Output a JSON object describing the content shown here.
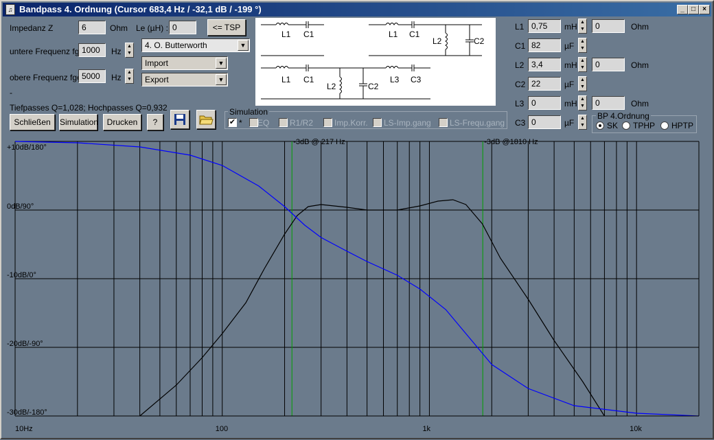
{
  "window": {
    "title": "Bandpass 4. Ordnung (Cursor 683,4 Hz / -32,1 dB / -199 °)",
    "icon": "speaker-icon"
  },
  "left": {
    "impedanz_label": "Impedanz Z",
    "impedanz_value": "6",
    "impedanz_unit": "Ohm",
    "le_label": "Le (µH) :",
    "le_value": "0",
    "tsp_label": "<= TSP",
    "fgu_label": "untere Frequenz fgu",
    "fgu_value": "1000",
    "fgu_unit": "Hz",
    "fgo_label": "obere Frequenz fgo",
    "fgo_value": "5000",
    "fgo_unit": "Hz",
    "filter_type": "4. O. Butterworth",
    "import_label": "Import",
    "export_label": "Export",
    "dot": "-",
    "q_text": "Tiefpasses Q=1,028; Hochpasses Q=0,932"
  },
  "buttons": {
    "close": "Schließen",
    "simulation": "Simulation",
    "print": "Drucken",
    "help": "?"
  },
  "schematic": {
    "l1": "L1",
    "c1": "C1",
    "l2": "L2",
    "c2": "C2",
    "l3": "L3",
    "c3": "C3"
  },
  "simulation": {
    "title": "Simulation",
    "items": [
      {
        "label": "*",
        "checked": true
      },
      {
        "label": "EQ",
        "checked": false
      },
      {
        "label": "R1/R2",
        "checked": false
      },
      {
        "label": "Imp.Korr.",
        "checked": false
      },
      {
        "label": "LS-Imp.gang",
        "checked": false
      },
      {
        "label": "LS-Frequ.gang",
        "checked": false
      }
    ]
  },
  "components": [
    {
      "name": "L1",
      "value": "0,75",
      "unit": "mH",
      "ohm": "0",
      "ohm_unit": "Ohm"
    },
    {
      "name": "C1",
      "value": "82",
      "unit": "µF"
    },
    {
      "name": "L2",
      "value": "3,4",
      "unit": "mH",
      "ohm": "0",
      "ohm_unit": "Ohm"
    },
    {
      "name": "C2",
      "value": "22",
      "unit": "µF"
    },
    {
      "name": "L3",
      "value": "0",
      "unit": "mH",
      "ohm": "0",
      "ohm_unit": "Ohm"
    },
    {
      "name": "C3",
      "value": "0",
      "unit": "µF"
    }
  ],
  "bp_group": {
    "title": "BP 4.Ordnung",
    "options": [
      "SK",
      "TPHP",
      "HPTP"
    ],
    "selected": "SK"
  },
  "chart_data": {
    "type": "line",
    "x_scale": "log",
    "xlim": [
      10,
      20000
    ],
    "x_ticks": [
      {
        "value": 10,
        "label": "10Hz"
      },
      {
        "value": 100,
        "label": "100"
      },
      {
        "value": 1000,
        "label": "1k"
      },
      {
        "value": 10000,
        "label": "10k"
      }
    ],
    "ylim": [
      -30,
      10
    ],
    "y_ticks": [
      {
        "value": 10,
        "label": "+10dB/180°"
      },
      {
        "value": 0,
        "label": "0dB/90°"
      },
      {
        "value": -10,
        "label": "-10dB/0°"
      },
      {
        "value": -20,
        "label": "-20dB/-90°"
      },
      {
        "value": -30,
        "label": "-30dB/-180°"
      }
    ],
    "grid": true,
    "markers": [
      {
        "x": 217,
        "label": "-3dB @ 217 Hz",
        "color": "#00a000"
      },
      {
        "x": 1810,
        "label": "-3dB @1810 Hz",
        "color": "#00a000"
      }
    ],
    "series": [
      {
        "color": "#000000",
        "points": [
          [
            40,
            -30
          ],
          [
            60,
            -25.5
          ],
          [
            80,
            -21.5
          ],
          [
            100,
            -18
          ],
          [
            130,
            -13.5
          ],
          [
            160,
            -8.5
          ],
          [
            200,
            -3.5
          ],
          [
            230,
            -0.8
          ],
          [
            260,
            0.5
          ],
          [
            300,
            0.8
          ],
          [
            400,
            0.4
          ],
          [
            500,
            0
          ],
          [
            700,
            0
          ],
          [
            900,
            0.6
          ],
          [
            1100,
            1.3
          ],
          [
            1300,
            1.5
          ],
          [
            1500,
            0.8
          ],
          [
            1800,
            -2
          ],
          [
            2200,
            -7
          ],
          [
            3000,
            -13
          ],
          [
            4000,
            -19
          ],
          [
            5500,
            -25
          ],
          [
            7000,
            -30
          ]
        ]
      },
      {
        "color": "#0000ff",
        "points": [
          [
            10,
            10
          ],
          [
            20,
            9.8
          ],
          [
            40,
            9.2
          ],
          [
            70,
            8
          ],
          [
            100,
            6.5
          ],
          [
            150,
            3.5
          ],
          [
            200,
            0.5
          ],
          [
            250,
            -2.2
          ],
          [
            300,
            -4
          ],
          [
            400,
            -6
          ],
          [
            500,
            -7.5
          ],
          [
            700,
            -9.5
          ],
          [
            900,
            -11.5
          ],
          [
            1200,
            -14.5
          ],
          [
            1500,
            -18
          ],
          [
            2000,
            -22.5
          ],
          [
            3000,
            -26
          ],
          [
            5000,
            -28.5
          ],
          [
            10000,
            -29.6
          ],
          [
            20000,
            -30
          ]
        ]
      }
    ]
  }
}
